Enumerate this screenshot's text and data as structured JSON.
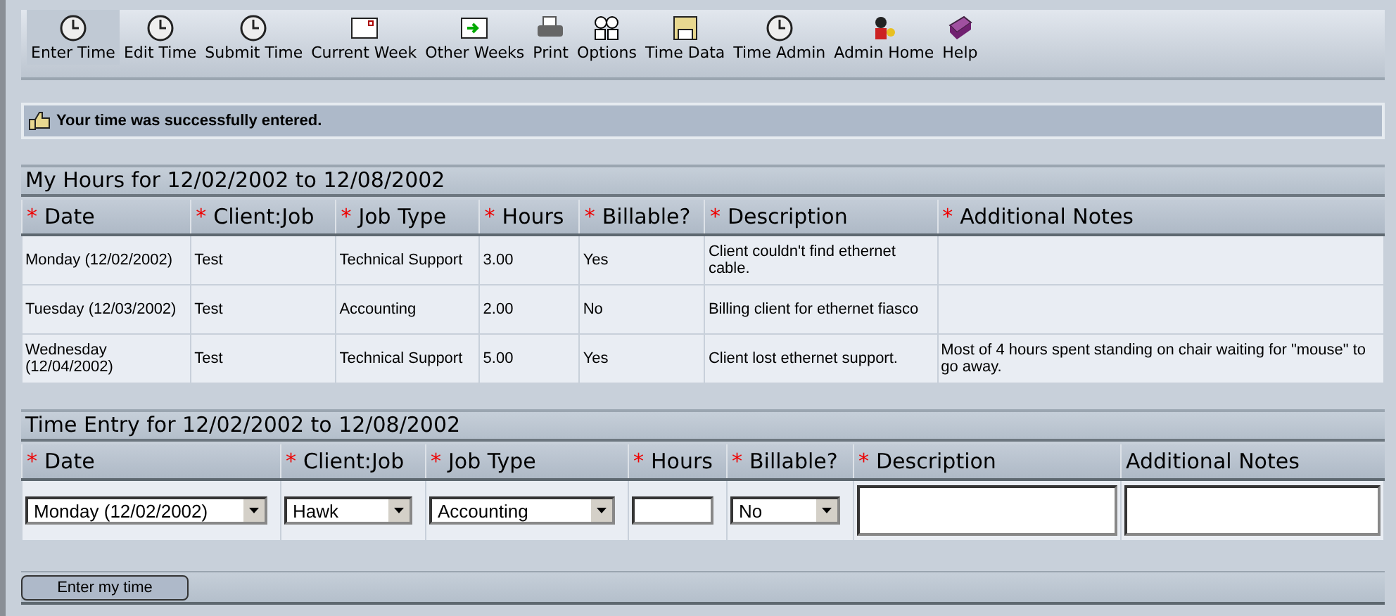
{
  "toolbar": [
    {
      "label": "Enter Time",
      "kind": "clock",
      "selected": true
    },
    {
      "label": "Edit Time",
      "kind": "clock",
      "selected": false
    },
    {
      "label": "Submit Time",
      "kind": "clock",
      "selected": false
    },
    {
      "label": "Current Week",
      "kind": "calendar",
      "selected": false
    },
    {
      "label": "Other Weeks",
      "kind": "calendar-arrow",
      "selected": false
    },
    {
      "label": "Print",
      "kind": "printer",
      "selected": false
    },
    {
      "label": "Options",
      "kind": "options",
      "selected": false
    },
    {
      "label": "Time Data",
      "kind": "floppy",
      "selected": false
    },
    {
      "label": "Time Admin",
      "kind": "clock",
      "selected": false
    },
    {
      "label": "Admin Home",
      "kind": "person",
      "selected": false
    },
    {
      "label": "Help",
      "kind": "book",
      "selected": false
    }
  ],
  "message": "Your time was successfully entered.",
  "hours": {
    "title": "My Hours for 12/02/2002 to 12/08/2002",
    "columns": [
      {
        "mark": "*",
        "label": "Date"
      },
      {
        "mark": "*",
        "label": "Client:Job"
      },
      {
        "mark": "*",
        "label": "Job Type"
      },
      {
        "mark": "*",
        "label": "Hours"
      },
      {
        "mark": "*",
        "label": "Billable?"
      },
      {
        "mark": "*",
        "label": "Description"
      },
      {
        "mark": "*",
        "label": "Additional Notes"
      }
    ],
    "rows": [
      [
        "Monday (12/02/2002)",
        "Test",
        "Technical Support",
        "3.00",
        "Yes",
        "Client couldn't find ethernet cable.",
        ""
      ],
      [
        "Tuesday (12/03/2002)",
        "Test",
        "Accounting",
        "2.00",
        "No",
        "Billing client for ethernet fiasco",
        ""
      ],
      [
        "Wednesday (12/04/2002)",
        "Test",
        "Technical Support",
        "5.00",
        "Yes",
        "Client lost ethernet support.",
        "Most of 4 hours spent standing on chair waiting for \"mouse\" to go away."
      ]
    ]
  },
  "entry": {
    "title": "Time Entry for 12/02/2002 to 12/08/2002",
    "columns": [
      {
        "mark": "*",
        "label": "Date"
      },
      {
        "mark": "*",
        "label": "Client:Job"
      },
      {
        "mark": "*",
        "label": "Job Type"
      },
      {
        "mark": "*",
        "label": "Hours"
      },
      {
        "mark": "*",
        "label": "Billable?"
      },
      {
        "mark": "*",
        "label": "Description"
      },
      {
        "label": "Additional Notes"
      }
    ],
    "fields": [
      {
        "kind": "select",
        "value": "Monday (12/02/2002)"
      },
      {
        "kind": "select",
        "value": "Hawk"
      },
      {
        "kind": "select",
        "value": "Accounting"
      },
      {
        "kind": "text"
      },
      {
        "kind": "select",
        "value": "No"
      },
      {
        "kind": "textarea"
      },
      {
        "kind": "textarea"
      }
    ]
  },
  "submit": "Enter my time"
}
